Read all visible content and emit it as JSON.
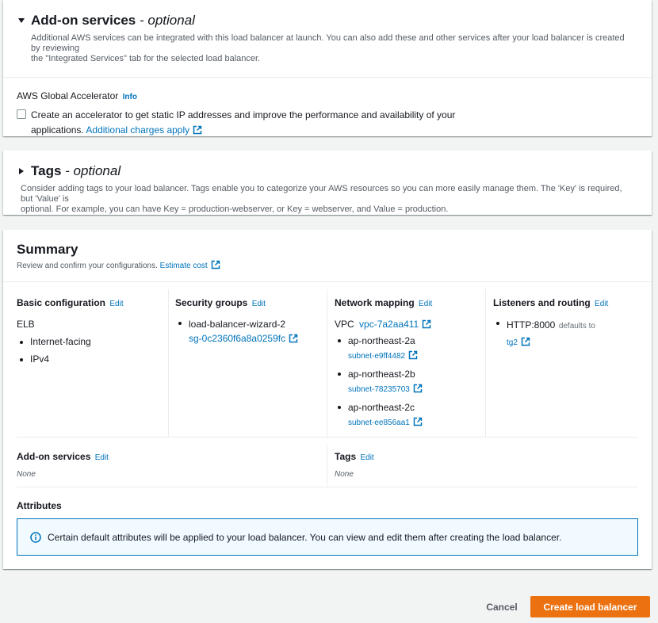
{
  "addon": {
    "title": "Add-on services",
    "suffix": "- optional",
    "description_line1": "Additional AWS services can be integrated with this load balancer at launch. You can also add these and other services after your load balancer is created by reviewing",
    "description_line2": "the \"Integrated Services\" tab for the selected load balancer.",
    "accelerator_label": "AWS Global Accelerator",
    "info": "Info",
    "checkbox_line1": "Create an accelerator to get static IP addresses and improve the performance and availability of your",
    "checkbox_line2_prefix": "applications.",
    "charges_link": "Additional charges apply"
  },
  "tags_section": {
    "title": "Tags",
    "suffix": "- optional",
    "description_line1": "Consider adding tags to your load balancer. Tags enable you to categorize your AWS resources so you can more easily manage them. The 'Key' is required, but 'Value' is",
    "description_line2": "optional. For example, you can have Key = production-webserver, or Key = webserver, and Value = production."
  },
  "summary": {
    "title": "Summary",
    "description": "Review and confirm your configurations.",
    "estimate_link": "Estimate cost",
    "edit_label": "Edit",
    "basic": {
      "title": "Basic configuration",
      "name": "ELB",
      "items": [
        "Internet-facing",
        "IPv4"
      ]
    },
    "security": {
      "title": "Security groups",
      "group_name": "load-balancer-wizard-2",
      "group_id": "sg-0c2360f6a8a0259fc"
    },
    "network": {
      "title": "Network mapping",
      "vpc_label": "VPC",
      "vpc_id": "vpc-7a2aa411",
      "subnets": [
        {
          "az": "ap-northeast-2a",
          "subnet": "subnet-e9ff4482"
        },
        {
          "az": "ap-northeast-2b",
          "subnet": "subnet-78235703"
        },
        {
          "az": "ap-northeast-2c",
          "subnet": "subnet-ee856aa1"
        }
      ]
    },
    "listeners": {
      "title": "Listeners and routing",
      "listener": "HTTP:8000",
      "defaults_to": "defaults to",
      "target": "tg2"
    },
    "addon_services": {
      "title": "Add-on services",
      "value": "None"
    },
    "tags": {
      "title": "Tags",
      "value": "None"
    },
    "attributes": {
      "title": "Attributes",
      "alert": "Certain default attributes will be applied to your load balancer. You can view and edit them after creating the load balancer."
    }
  },
  "footer": {
    "cancel": "Cancel",
    "create": "Create load balancer"
  },
  "colors": {
    "link": "#0073bb",
    "primary": "#ec7211",
    "background": "#f2f3f3"
  }
}
